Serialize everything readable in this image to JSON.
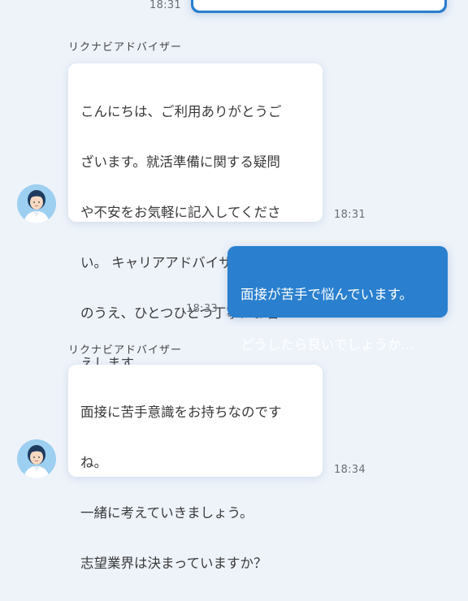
{
  "conversation": {
    "top": {
      "time": "18:31"
    },
    "msg1": {
      "sender": "リクナビアドバイザー",
      "lines": [
        "こんにちは、ご利用ありがとうご",
        "ざいます。就活準備に関する疑問",
        "や不安をお気軽に記入してくださ",
        "い。 キャリアアドバイザーが確認",
        "のうえ、ひとつひとつ丁寧にお答",
        "えします。"
      ],
      "time": "18:31"
    },
    "msg2": {
      "lines": [
        "面接が苦手で悩んでいます。",
        "どうしたら良いでしょうか..."
      ],
      "time": "18:33"
    },
    "msg3": {
      "sender": "リクナビアドバイザー",
      "lines": [
        "面接に苦手意識をお持ちなのです",
        "ね。",
        "一緒に考えていきましょう。",
        "志望業界は決まっていますか？"
      ],
      "time": "18:34"
    }
  },
  "colors": {
    "background": "#eef3fa",
    "user_bubble": "#2a7fce",
    "advisor_bubble": "#ffffff",
    "avatar_bg": "#9dcff0"
  },
  "icons": {
    "advisor_avatar": "advisor-avatar-icon"
  }
}
